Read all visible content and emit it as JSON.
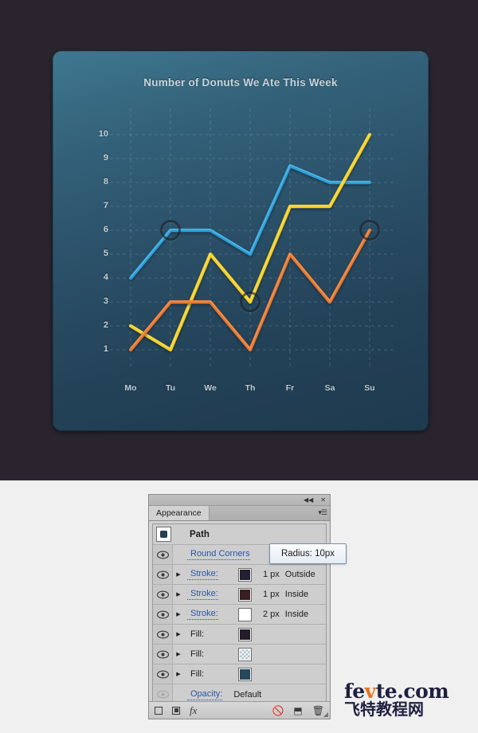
{
  "page": {
    "top_bg": "#29242e",
    "bottom_bg": "#f0f0f0"
  },
  "chart_card": {
    "bg_top": "#3e7890",
    "bg_bottom": "#1e3a4e"
  },
  "chart_data": {
    "type": "line",
    "title": "Number of Donuts We Ate This Week",
    "xlabel": "",
    "ylabel": "",
    "categories": [
      "Mo",
      "Tu",
      "We",
      "Th",
      "Fr",
      "Sa",
      "Su"
    ],
    "ylim": [
      1,
      10
    ],
    "yticks": [
      "1",
      "2",
      "3",
      "4",
      "5",
      "6",
      "7",
      "8",
      "9",
      "10"
    ],
    "grid": true,
    "legend": "none",
    "series": [
      {
        "name": "blue",
        "color": "#2c9fd8",
        "values": [
          4,
          6,
          6,
          5,
          8.7,
          8,
          8
        ]
      },
      {
        "name": "yellow",
        "color": "#f5d020",
        "values": [
          2,
          1,
          5,
          3,
          7,
          7,
          10
        ]
      },
      {
        "name": "orange",
        "color": "#e8762c",
        "values": [
          1,
          3,
          3,
          1,
          5,
          3,
          6
        ]
      }
    ],
    "markers": [
      {
        "series": "blue",
        "category": "Tu",
        "value": 6
      },
      {
        "series": "yellow",
        "category": "Th",
        "value": 3
      },
      {
        "series": "orange",
        "category": "Su",
        "value": 6
      }
    ]
  },
  "panel": {
    "titlebar": {
      "collapse_icon": "◀◀",
      "close_icon": "✕"
    },
    "tab_label": "Appearance",
    "menu_icon": "▾☰",
    "path_row": {
      "name": "Path",
      "thumb": "path-thumbnail-icon"
    },
    "rows": [
      {
        "eye": "visible",
        "has_arrow": false,
        "label": "Round Corners",
        "is_link": true,
        "swatch": null,
        "meta": "",
        "position": ""
      },
      {
        "eye": "visible",
        "has_arrow": true,
        "label": "Stroke:",
        "is_link": true,
        "swatch": "#241f2e",
        "swatch_type": "solid",
        "meta": "1 px",
        "position": "Outside"
      },
      {
        "eye": "visible",
        "has_arrow": true,
        "label": "Stroke:",
        "is_link": true,
        "swatch": "#3a1f22",
        "swatch_type": "solid",
        "meta": "1 px",
        "position": "Inside"
      },
      {
        "eye": "visible",
        "has_arrow": true,
        "label": "Stroke:",
        "is_link": true,
        "swatch": "#ffffff",
        "swatch_type": "solid",
        "meta": "2 px",
        "position": "Inside"
      },
      {
        "eye": "visible",
        "has_arrow": true,
        "label": "Fill:",
        "is_link": false,
        "swatch": "#221d28",
        "swatch_type": "solid",
        "meta": "",
        "position": ""
      },
      {
        "eye": "visible",
        "has_arrow": true,
        "label": "Fill:",
        "is_link": false,
        "swatch": null,
        "swatch_type": "checker",
        "meta": "",
        "position": ""
      },
      {
        "eye": "visible",
        "has_arrow": true,
        "label": "Fill:",
        "is_link": false,
        "swatch": "#27485c",
        "swatch_type": "solid",
        "meta": "",
        "position": ""
      },
      {
        "eye": "dimmed",
        "has_arrow": false,
        "label": "Opacity:",
        "is_link": true,
        "swatch": null,
        "meta": "Default",
        "position": ""
      }
    ],
    "footer": {
      "new_art_label": "new-art-icon",
      "duplicate_label": "duplicate-icon",
      "fx_label": "fx",
      "clear_label": "clear-appearance-icon",
      "copy_label": "copy-icon",
      "delete_label": "delete-icon"
    }
  },
  "tooltip": {
    "text": "Radius: 10px"
  },
  "watermark": {
    "line1_a": "fe",
    "line1_b": "v",
    "line1_c": "te.com",
    "line2": "飞特教程网",
    "accent": "#e8731d"
  }
}
